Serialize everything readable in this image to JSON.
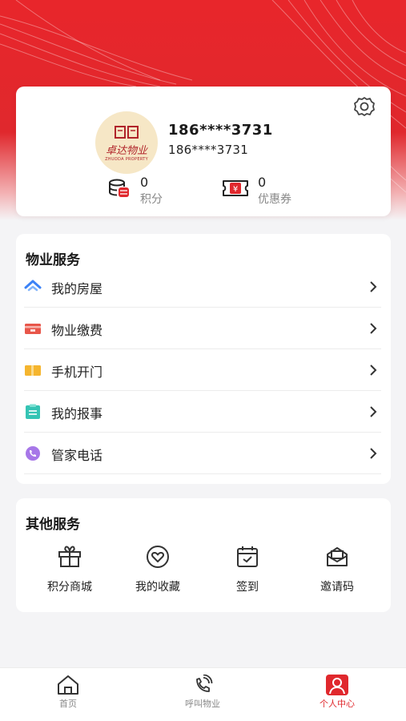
{
  "profile": {
    "logo_text_cn": "卓达物业",
    "logo_text_en": "ZHUODA PROPERTY",
    "phone_main": "186****3731",
    "phone_sub": "186****3731",
    "points_value": "0",
    "points_label": "积分",
    "coupons_value": "0",
    "coupons_label": "优惠券"
  },
  "property_services": {
    "title": "物业服务",
    "items": [
      {
        "label": "我的房屋",
        "icon": "house-icon"
      },
      {
        "label": "物业缴费",
        "icon": "wallet-icon"
      },
      {
        "label": "手机开门",
        "icon": "door-card-icon"
      },
      {
        "label": "我的报事",
        "icon": "clipboard-icon"
      },
      {
        "label": "管家电话",
        "icon": "phone-icon"
      }
    ]
  },
  "other_services": {
    "title": "其他服务",
    "items": [
      {
        "label": "积分商城",
        "icon": "gift-icon"
      },
      {
        "label": "我的收藏",
        "icon": "heart-icon"
      },
      {
        "label": "签到",
        "icon": "calendar-check-icon"
      },
      {
        "label": "邀请码",
        "icon": "mail-icon"
      }
    ]
  },
  "tabbar": {
    "home": "首页",
    "call": "呼叫物业",
    "me": "个人中心"
  },
  "colors": {
    "brand_red": "#e0282d",
    "house_blue": "#3b82f6",
    "wallet_red": "#e8564a",
    "door_yellow": "#f5b52e",
    "clipboard_teal": "#35c4b4",
    "phone_purple": "#a777e8"
  }
}
